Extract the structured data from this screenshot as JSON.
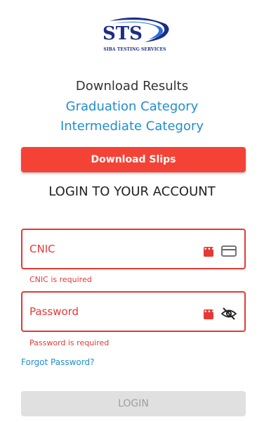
{
  "logo": {
    "mark": "STS",
    "subtitle": "SIBA TESTING SERVICES"
  },
  "results": {
    "heading": "Download Results",
    "links": [
      "Graduation Category",
      "Intermediate Category"
    ]
  },
  "download_slips_label": "Download Slips",
  "login": {
    "title": "LOGIN TO YOUR ACCOUNT",
    "cnic": {
      "label": "CNIC",
      "error": "CNIC is required",
      "icon": "card-icon"
    },
    "password": {
      "label": "Password",
      "error": "Password is required",
      "icon": "eye-off-icon"
    },
    "forgot_label": "Forgot Password?",
    "submit_label": "LOGIN"
  },
  "colors": {
    "accent": "#f44336",
    "error": "#e53935",
    "link": "#1f8ed1",
    "logo": "#1c2e83"
  }
}
